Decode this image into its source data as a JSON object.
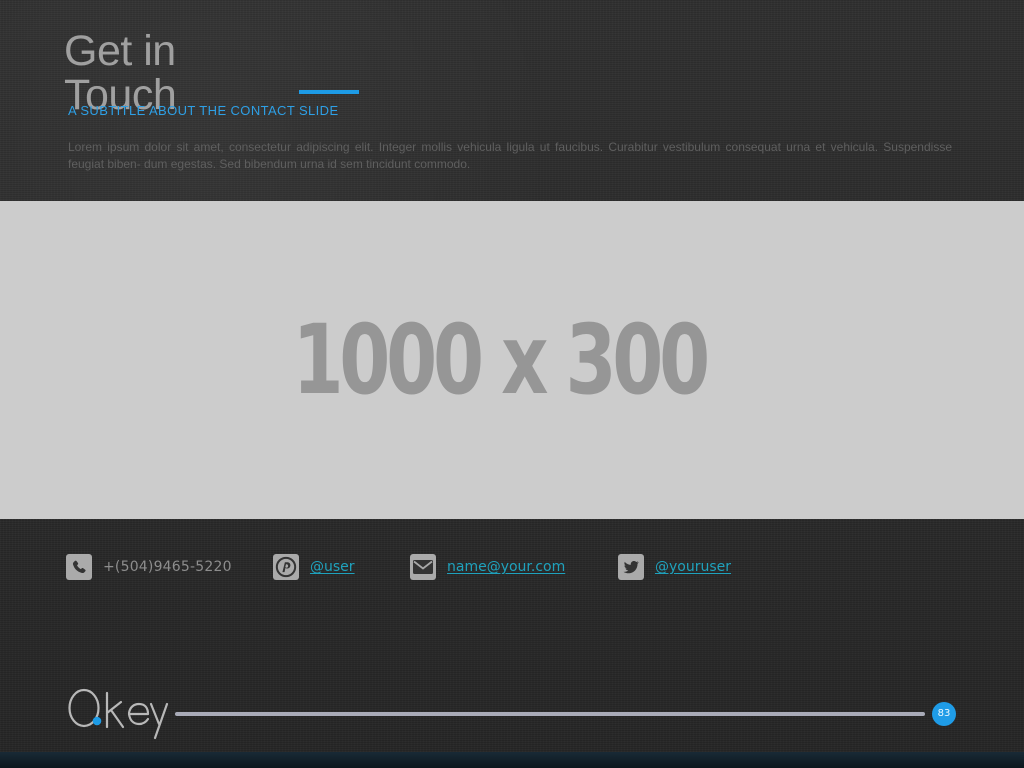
{
  "slide": {
    "title": "Get in Touch",
    "subtitle": "A SUBTITLE ABOUT THE CONTACT SLIDE",
    "body": "Lorem ipsum dolor sit amet, consectetur adipiscing elit. Integer mollis vehicula ligula ut faucibus. Curabitur vestibulum consequat urna et vehicula. Suspendisse feugiat biben- dum egestas. Sed bibendum urna id sem tincidunt commodo.",
    "image_placeholder": "1000 x 300",
    "page_number": "83"
  },
  "contacts": [
    {
      "icon": "phone-icon",
      "label": "+(504)9465-5220"
    },
    {
      "icon": "pinterest-icon",
      "label": "@user"
    },
    {
      "icon": "email-icon",
      "label": "name@your.com"
    },
    {
      "icon": "twitter-icon",
      "label": "@youruser"
    }
  ],
  "branding": {
    "logo_text": "Okey"
  },
  "colors": {
    "accent": "#1d9be6",
    "link": "#1fa2bd",
    "placeholder_bg": "#cccccc",
    "icon_bg": "#aaaaaa"
  }
}
